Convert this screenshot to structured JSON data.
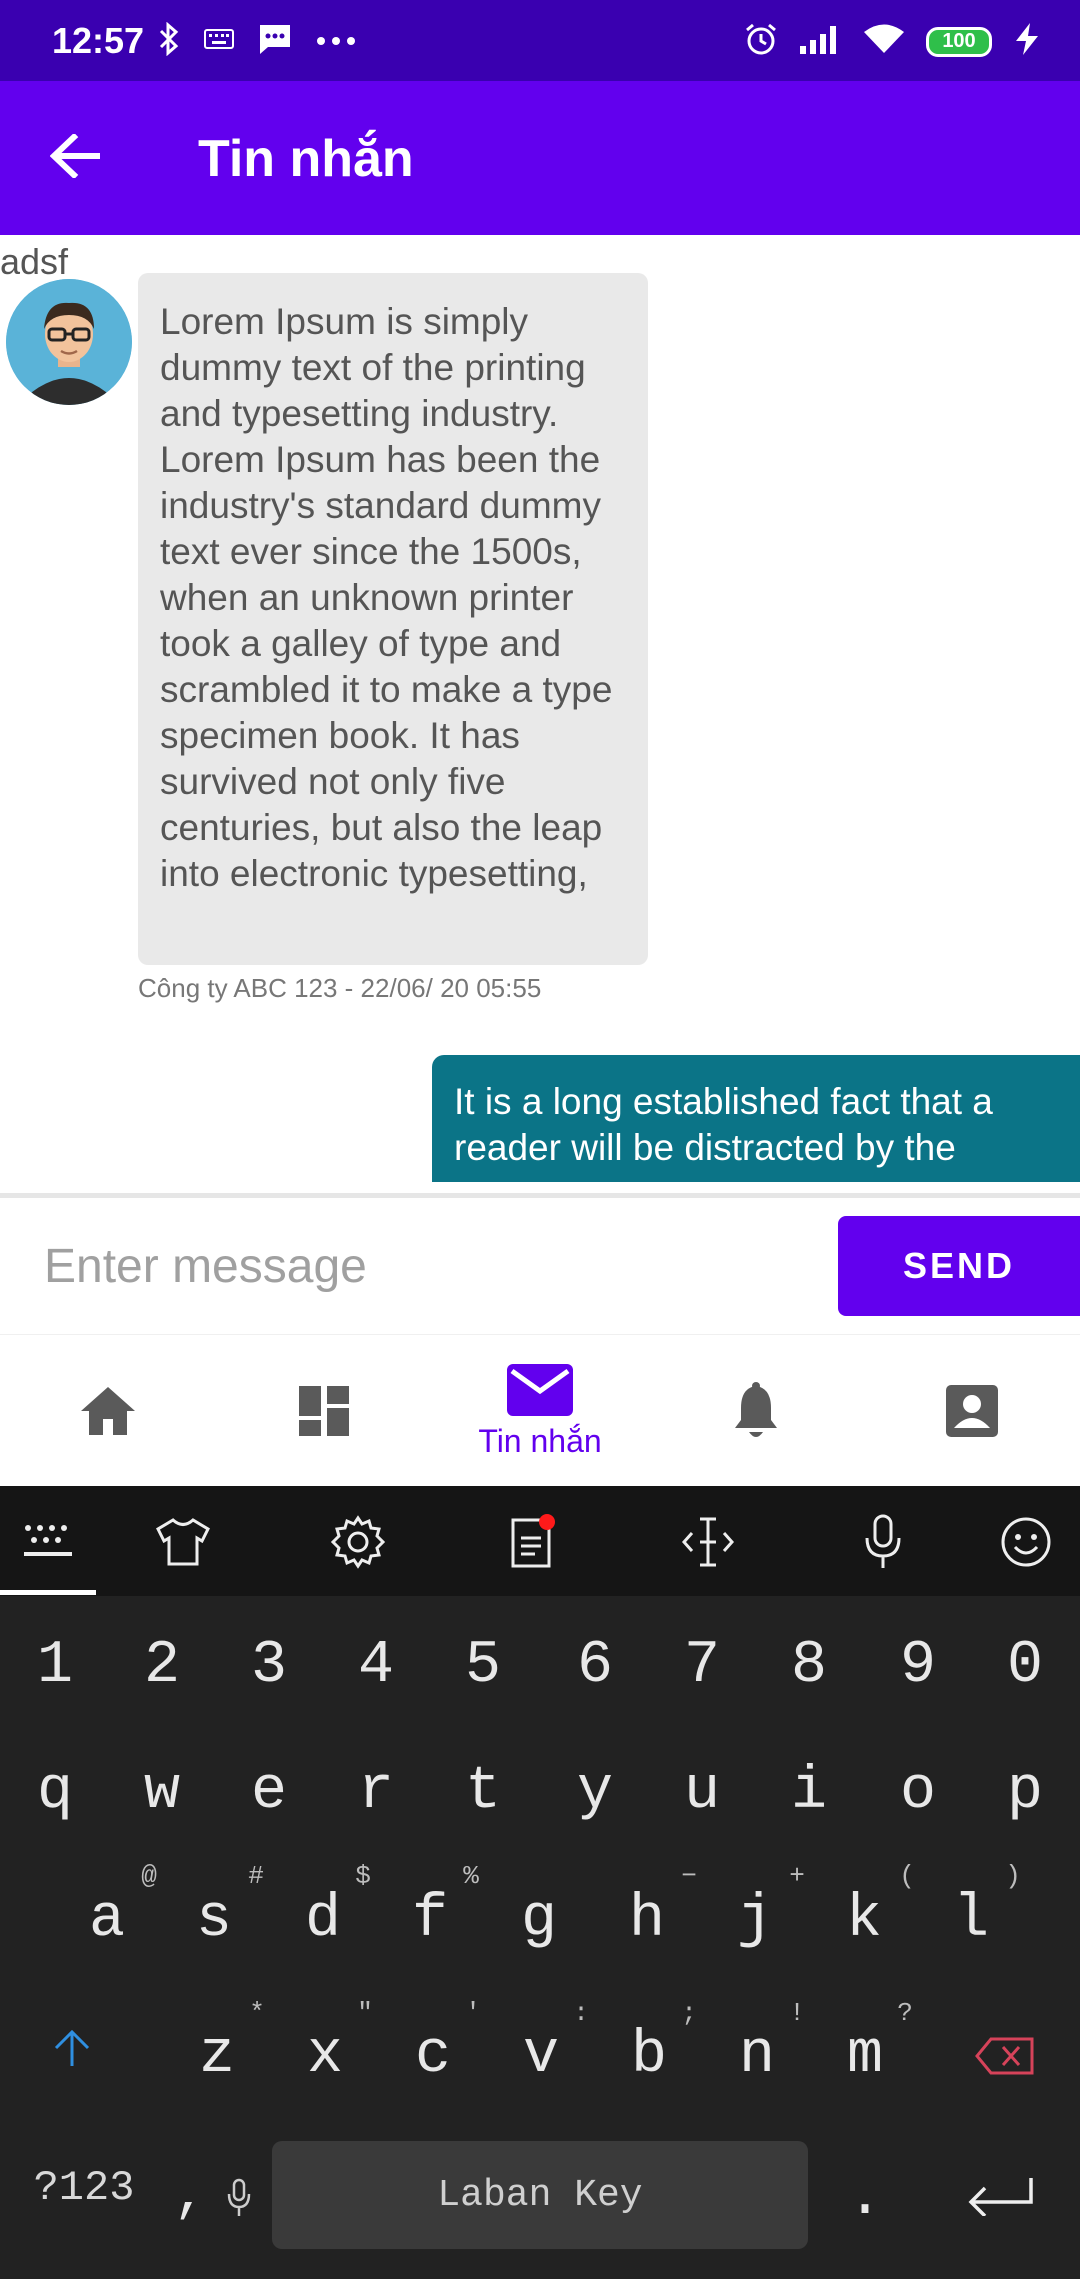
{
  "status_bar": {
    "time": "12:57",
    "icons_left": [
      "bluetooth-icon",
      "keyboard-icon",
      "sms-icon",
      "more-icon"
    ],
    "icons_right": [
      "alarm-icon",
      "signal-icon",
      "wifi-icon",
      "battery-icon",
      "charging-icon"
    ],
    "battery": "100"
  },
  "app_bar": {
    "title": "Tin nhắn",
    "back_icon": "arrow-back-icon"
  },
  "messages": [
    {
      "direction": "incoming",
      "sender": "adsf",
      "text": "Lorem Ipsum is simply dummy text of the printing and typesetting industry. Lorem Ipsum has been the industry's standard dummy text ever since the 1500s, when an unknown printer took a galley of type and scrambled it to make a type specimen book. It has survived not only five centuries, but also the leap into electronic typesetting,",
      "meta": "Công ty ABC 123 - 22/06/ 20 05:55"
    },
    {
      "direction": "outgoing",
      "text": "It is a long established fact that a reader will be distracted by the"
    }
  ],
  "input": {
    "placeholder": "Enter message",
    "value": "",
    "send_label": "SEND"
  },
  "bottom_nav": {
    "items": [
      {
        "icon": "home-icon",
        "label": ""
      },
      {
        "icon": "dashboard-icon",
        "label": ""
      },
      {
        "icon": "mail-icon",
        "label": "Tin nhắn",
        "active": true
      },
      {
        "icon": "bell-icon",
        "label": ""
      },
      {
        "icon": "contact-icon",
        "label": ""
      }
    ],
    "active_color": "#6200ee"
  },
  "keyboard": {
    "toolbar": [
      "keyboard-hide-icon",
      "shirt-icon",
      "settings-icon",
      "clipboard-icon",
      "cursor-icon",
      "mic-icon",
      "emoji-icon"
    ],
    "row_numbers": [
      "1",
      "2",
      "3",
      "4",
      "5",
      "6",
      "7",
      "8",
      "9",
      "0"
    ],
    "row1": [
      "q",
      "w",
      "e",
      "r",
      "t",
      "y",
      "u",
      "i",
      "o",
      "p"
    ],
    "row2": [
      "a",
      "s",
      "d",
      "f",
      "g",
      "h",
      "j",
      "k",
      "l"
    ],
    "row2_hints": [
      "@",
      "#",
      "$",
      "%",
      "−",
      "+",
      "(",
      ")"
    ],
    "row3": [
      "z",
      "x",
      "c",
      "v",
      "b",
      "n",
      "m"
    ],
    "row3_hints": [
      "*",
      "\"",
      "'",
      ":",
      ";",
      "!",
      "?"
    ],
    "symbols_key": "?123",
    "comma_key": ",",
    "space_label": "Laban Key",
    "period_key": "."
  },
  "colors": {
    "status_bar": "#3a00b0",
    "primary": "#6200ee",
    "outgoing_bubble": "#0b7487",
    "incoming_bubble": "#e9e9e9"
  }
}
